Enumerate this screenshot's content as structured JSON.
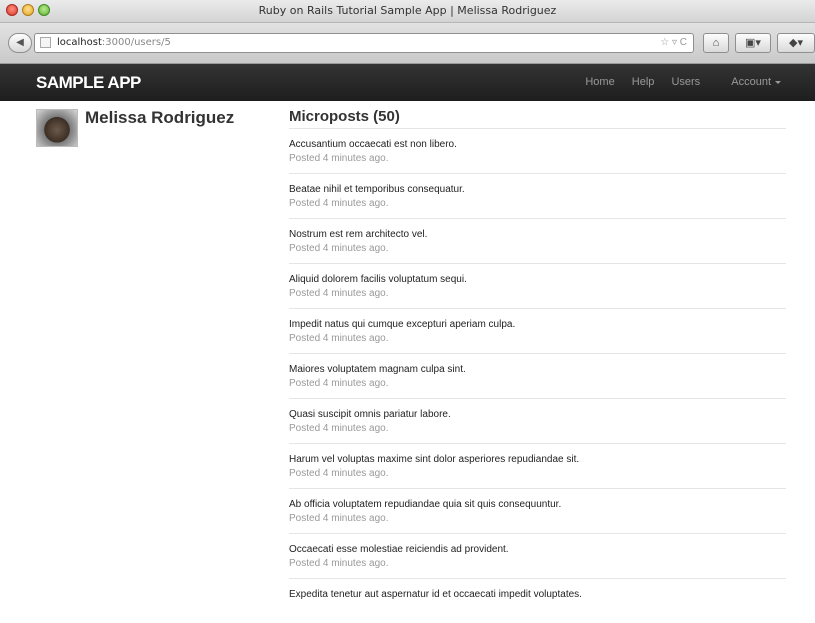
{
  "window": {
    "title": "Ruby on Rails Tutorial Sample App | Melissa Rodriguez"
  },
  "browser": {
    "url_host": "localhost",
    "url_path": ":3000/users/5",
    "back_glyph": "◀",
    "url_icons": "☆ ▿ C",
    "home_glyph": "⌂",
    "bookmarks_glyph": "▣▾",
    "extra_glyph": "◆▾"
  },
  "navbar": {
    "logo": "SAMPLE APP",
    "links": {
      "home": "Home",
      "help": "Help",
      "users": "Users",
      "account": "Account"
    }
  },
  "user": {
    "name": "Melissa Rodriguez"
  },
  "microposts": {
    "title": "Microposts (50)",
    "items": [
      {
        "content": "Accusantium occaecati est non libero.",
        "timestamp": "Posted 4 minutes ago."
      },
      {
        "content": "Beatae nihil et temporibus consequatur.",
        "timestamp": "Posted 4 minutes ago."
      },
      {
        "content": "Nostrum est rem architecto vel.",
        "timestamp": "Posted 4 minutes ago."
      },
      {
        "content": "Aliquid dolorem facilis voluptatum sequi.",
        "timestamp": "Posted 4 minutes ago."
      },
      {
        "content": "Impedit natus qui cumque excepturi aperiam culpa.",
        "timestamp": "Posted 4 minutes ago."
      },
      {
        "content": "Maiores voluptatem magnam culpa sint.",
        "timestamp": "Posted 4 minutes ago."
      },
      {
        "content": "Quasi suscipit omnis pariatur labore.",
        "timestamp": "Posted 4 minutes ago."
      },
      {
        "content": "Harum vel voluptas maxime sint dolor asperiores repudiandae sit.",
        "timestamp": "Posted 4 minutes ago."
      },
      {
        "content": "Ab officia voluptatem repudiandae quia sit quis consequuntur.",
        "timestamp": "Posted 4 minutes ago."
      },
      {
        "content": "Occaecati esse molestiae reiciendis ad provident.",
        "timestamp": "Posted 4 minutes ago."
      },
      {
        "content": "Expedita tenetur aut aspernatur id et occaecati impedit voluptates.",
        "timestamp": ""
      }
    ]
  }
}
